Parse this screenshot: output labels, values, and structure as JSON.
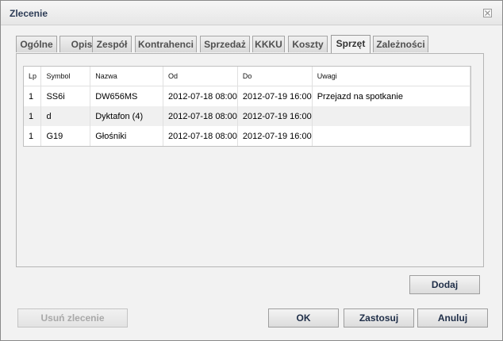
{
  "window": {
    "title": "Zlecenie"
  },
  "tabs": [
    {
      "label": "Ogólne"
    },
    {
      "label": "Opis"
    },
    {
      "label": "Zespół"
    },
    {
      "label": "Kontrahenci"
    },
    {
      "label": "Sprzedaż"
    },
    {
      "label": "KKKU"
    },
    {
      "label": "Koszty"
    },
    {
      "label": "Sprzęt",
      "active": true
    },
    {
      "label": "Zależności"
    }
  ],
  "table": {
    "columns": [
      "Lp",
      "Symbol",
      "Nazwa",
      "Od",
      "Do",
      "Uwagi"
    ],
    "rows": [
      [
        "1",
        "SS6i",
        "DW656MS",
        "2012-07-18 08:00",
        "2012-07-19 16:00",
        "Przejazd na spotkanie"
      ],
      [
        "1",
        "d",
        "Dyktafon (4)",
        "2012-07-18 08:00",
        "2012-07-19 16:00",
        ""
      ],
      [
        "1",
        "G19",
        "Głośniki",
        "2012-07-18 08:00",
        "2012-07-19 16:00",
        ""
      ]
    ]
  },
  "buttons": {
    "add": "Dodaj",
    "delete_order": "Usuń zlecenie",
    "ok": "OK",
    "apply": "Zastosuj",
    "cancel": "Anuluj"
  }
}
